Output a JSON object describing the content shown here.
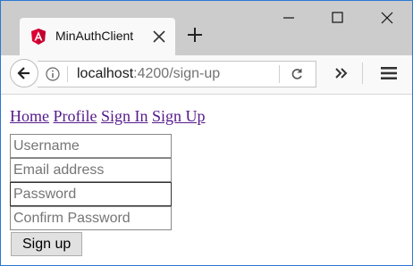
{
  "browser": {
    "tab": {
      "title": "MinAuthClient",
      "favicon": "angular-icon"
    },
    "url": {
      "host": "localhost",
      "rest": ":4200/sign-up"
    },
    "colors": {
      "titlebar": "#cccccc",
      "tab_background": "#f9f9f9",
      "angular_red": "#dd0031",
      "link_visited": "#551a8b"
    }
  },
  "nav": {
    "home": "Home",
    "profile": "Profile",
    "sign_in": "Sign In",
    "sign_up": "Sign Up"
  },
  "form": {
    "username_placeholder": "Username",
    "email_placeholder": "Email address",
    "password_placeholder": "Password",
    "confirm_placeholder": "Confirm Password",
    "submit_label": "Sign up"
  }
}
